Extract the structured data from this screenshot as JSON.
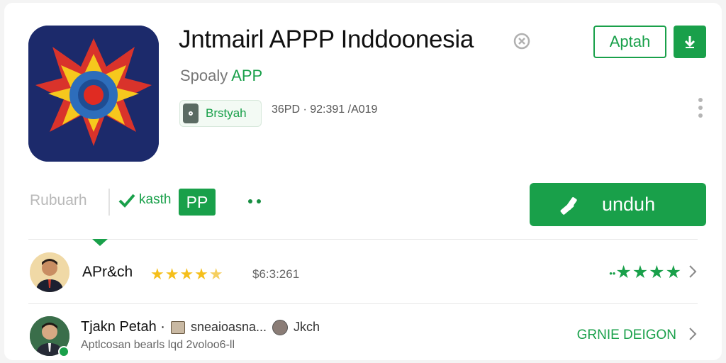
{
  "app": {
    "title": "Jntmairl APPP Inddoonesia",
    "subtitle_prefix": "Spoaly",
    "subtitle_accent": "APP",
    "tag_label": "Brstyah",
    "meta": "36PD · 92:391 /A019"
  },
  "header_actions": {
    "outline_button": "Aptah",
    "download_icon": "download-icon",
    "more_icon": "more-vertical-icon"
  },
  "tabs": {
    "inactive": "Rubuarh",
    "active": "kasth",
    "pill": "PP",
    "more_icon": "more-dots-icon"
  },
  "primary_button": {
    "label": "unduh",
    "icon": "hammer-icon"
  },
  "reviews": [
    {
      "name": "APr&ch",
      "stars": "★★★★",
      "stars_partial": "★",
      "value": "$6:3:261",
      "rating_prefix": "••",
      "rating_stars": "★★★★"
    },
    {
      "name": "Tjakn Petah ·",
      "secondary": "sneaioasna...",
      "tertiary": "Jkch",
      "detail": "Aptlcosan bearls lqd 2voloo6-ll",
      "link": "GRNIE DEIGON"
    }
  ],
  "colors": {
    "accent": "#19a04a",
    "star": "#f5bf1b",
    "icon_bg": "#1c2a6b"
  }
}
